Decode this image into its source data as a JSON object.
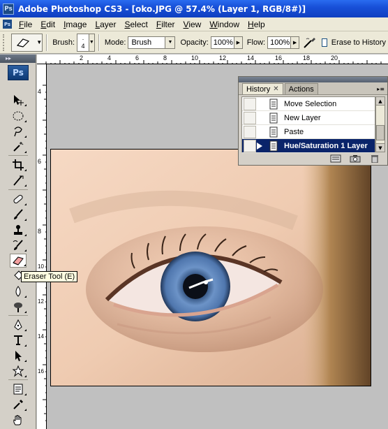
{
  "window": {
    "app_icon": "ps-icon",
    "app_icon_text": "Ps",
    "title": "Adobe Photoshop CS3 - [oko.JPG @ 57.4% (Layer 1, RGB/8#)]"
  },
  "menu": [
    "File",
    "Edit",
    "Image",
    "Layer",
    "Select",
    "Filter",
    "View",
    "Window",
    "Help"
  ],
  "options": {
    "brush_label": "Brush:",
    "brush_size": "4",
    "mode_label": "Mode:",
    "mode_value": "Brush",
    "opacity_label": "Opacity:",
    "opacity_value": "100%",
    "flow_label": "Flow:",
    "flow_value": "100%",
    "erase_to_history_label": "Erase to History",
    "erase_to_history_checked": false
  },
  "toolbox": {
    "logo": "Ps",
    "active_tool": "eraser-tool",
    "tools": [
      "move-tool",
      "marquee-tool",
      "lasso-tool",
      "magic-wand-tool",
      "crop-tool",
      "eyedropper-tool",
      "healing-brush-tool",
      "brush-tool",
      "clone-stamp-tool",
      "history-brush-tool",
      "eraser-tool",
      "paint-bucket-tool",
      "blur-tool",
      "dodge-tool",
      "pen-tool",
      "type-tool",
      "path-selection-tool",
      "custom-shape-tool",
      "notes-tool",
      "eyedropper-tool-2",
      "hand-tool"
    ]
  },
  "tooltip": "Eraser Tool (E)",
  "ruler": {
    "top_numbers": [
      "2",
      "4",
      "6",
      "8",
      "10",
      "12",
      "14",
      "16",
      "18",
      "20"
    ],
    "left_numbers": [
      "4",
      "6",
      "8",
      "10",
      "12",
      "14",
      "16"
    ]
  },
  "history_panel": {
    "tabs": [
      {
        "label": "History",
        "active": true
      },
      {
        "label": "Actions",
        "active": false
      }
    ],
    "items": [
      {
        "label": "Move Selection",
        "selected": false
      },
      {
        "label": "New Layer",
        "selected": false
      },
      {
        "label": "Paste",
        "selected": false
      },
      {
        "label": "Hue/Saturation 1 Layer",
        "selected": true
      }
    ]
  },
  "colors": {
    "titlebar": "#1850d8",
    "chrome": "#ece9d8",
    "selection": "#0a246a",
    "iris": "#5f86bd"
  }
}
